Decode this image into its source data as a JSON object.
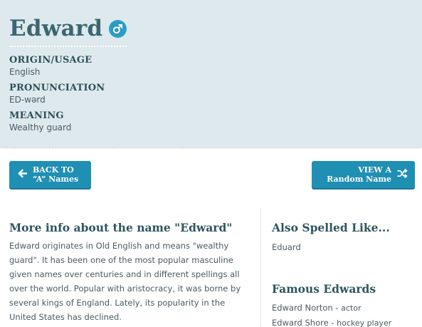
{
  "name": {
    "title": "Edward",
    "gender_icon": "male-symbol-icon",
    "accent_color": "#2c9cc5"
  },
  "facts": [
    {
      "label": "ORIGIN/USAGE",
      "value": "English"
    },
    {
      "label": "PRONUNCIATION",
      "value": "ED-wərd"
    },
    {
      "label": "MEANING",
      "value": "Wealthy guard"
    }
  ],
  "buttons": {
    "back_line1": "BACK TO",
    "back_line2": "“A” Names",
    "random_line1": "VIEW A",
    "random_line2": "Random Name",
    "color": "#1f8fb4"
  },
  "more_info": {
    "heading": "More info about the name \"Edward\"",
    "text": "Edward originates in Old English and means \"wealthy guard\". It has been one of the most popular masculine given names over centuries and in different spellings all over the world. Popular with aristocracy, it was borne by several kings of England. Lately, its popularity in the United States has declined."
  },
  "also_spelled": {
    "heading": "Also Spelled Like...",
    "items": [
      "Eduard"
    ]
  },
  "famous": {
    "heading": "Famous Edwards",
    "items": [
      {
        "name": "Edward Norton",
        "role": "actor"
      },
      {
        "name": "Edward Shore",
        "role": "hockey player"
      }
    ]
  }
}
